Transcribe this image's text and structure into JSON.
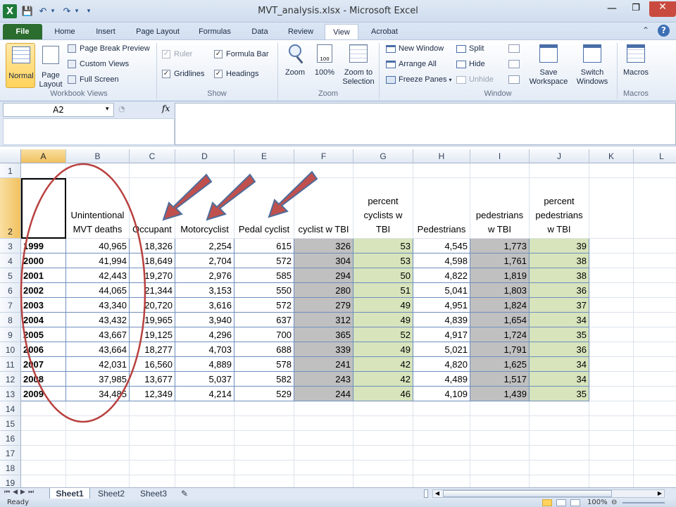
{
  "window": {
    "title": "MVT_analysis.xlsx  -  Microsoft Excel"
  },
  "ribbon_tabs": [
    "File",
    "Home",
    "Insert",
    "Page Layout",
    "Formulas",
    "Data",
    "Review",
    "View",
    "Acrobat"
  ],
  "ribbon": {
    "workbook_views": {
      "label": "Workbook Views",
      "normal": "Normal",
      "page_layout_line1": "Page",
      "page_layout_line2": "Layout",
      "page_break_preview": "Page Break Preview",
      "custom_views": "Custom Views",
      "full_screen": "Full Screen"
    },
    "show": {
      "label": "Show",
      "ruler": "Ruler",
      "formula_bar": "Formula Bar",
      "gridlines": "Gridlines",
      "headings": "Headings"
    },
    "zoom": {
      "label": "Zoom",
      "zoom": "Zoom",
      "hundred": "100%",
      "zoom_to_selection_line1": "Zoom to",
      "zoom_to_selection_line2": "Selection"
    },
    "window": {
      "label": "Window",
      "new_window": "New Window",
      "arrange_all": "Arrange All",
      "freeze_panes": "Freeze Panes",
      "split": "Split",
      "hide": "Hide",
      "unhide": "Unhide",
      "save_workspace_line1": "Save",
      "save_workspace_line2": "Workspace",
      "switch_windows_line1": "Switch",
      "switch_windows_line2": "Windows"
    },
    "macros": {
      "label": "Macros",
      "macros": "Macros"
    }
  },
  "formula_bar": {
    "name_box": "A2",
    "fx": "fx",
    "content": ""
  },
  "columns": [
    "A",
    "B",
    "C",
    "D",
    "E",
    "F",
    "G",
    "H",
    "I",
    "J",
    "K",
    "L"
  ],
  "rows": [
    "1",
    "2",
    "3",
    "4",
    "5",
    "6",
    "7",
    "8",
    "9",
    "10",
    "11",
    "12",
    "13",
    "14",
    "15",
    "16",
    "17",
    "18",
    "19"
  ],
  "headers": {
    "b_line1": "Unintentional",
    "b_line2": "MVT deaths",
    "c": "Occupant",
    "d": "Motorcyclist",
    "e": "Pedal cyclist",
    "f": "cyclist w TBI",
    "g_line1": "percent",
    "g_line2": "cyclists w TBI",
    "h": "Pedestrians",
    "i_line1": "pedestrians",
    "i_line2": "w TBI",
    "j_line1": "percent",
    "j_line2": "pedestrians",
    "j_line3": "w TBI"
  },
  "table": [
    [
      "1999",
      "40,965",
      "18,326",
      "2,254",
      "615",
      "326",
      "53",
      "4,545",
      "1,773",
      "39"
    ],
    [
      "2000",
      "41,994",
      "18,649",
      "2,704",
      "572",
      "304",
      "53",
      "4,598",
      "1,761",
      "38"
    ],
    [
      "2001",
      "42,443",
      "19,270",
      "2,976",
      "585",
      "294",
      "50",
      "4,822",
      "1,819",
      "38"
    ],
    [
      "2002",
      "44,065",
      "21,344",
      "3,153",
      "550",
      "280",
      "51",
      "5,041",
      "1,803",
      "36"
    ],
    [
      "2003",
      "43,340",
      "20,720",
      "3,616",
      "572",
      "279",
      "49",
      "4,951",
      "1,824",
      "37"
    ],
    [
      "2004",
      "43,432",
      "19,965",
      "3,940",
      "637",
      "312",
      "49",
      "4,839",
      "1,654",
      "34"
    ],
    [
      "2005",
      "43,667",
      "19,125",
      "4,296",
      "700",
      "365",
      "52",
      "4,917",
      "1,724",
      "35"
    ],
    [
      "2006",
      "43,664",
      "18,277",
      "4,703",
      "688",
      "339",
      "49",
      "5,021",
      "1,791",
      "36"
    ],
    [
      "2007",
      "42,031",
      "16,560",
      "4,889",
      "578",
      "241",
      "42",
      "4,820",
      "1,625",
      "34"
    ],
    [
      "2008",
      "37,985",
      "13,677",
      "5,037",
      "582",
      "243",
      "42",
      "4,489",
      "1,517",
      "34"
    ],
    [
      "2009",
      "34,485",
      "12,349",
      "4,214",
      "529",
      "244",
      "46",
      "4,109",
      "1,439",
      "35"
    ]
  ],
  "sheet_tabs": [
    "Sheet1",
    "Sheet2",
    "Sheet3"
  ],
  "status": {
    "ready": "Ready",
    "zoom": "100%"
  },
  "colors": {
    "gray_fill": "#c0c0c0",
    "green_fill": "#d7e4bc",
    "annotation_red": "#b8413f",
    "arrow_red": "#c0504d",
    "arrow_outline": "#4f6d9a"
  }
}
